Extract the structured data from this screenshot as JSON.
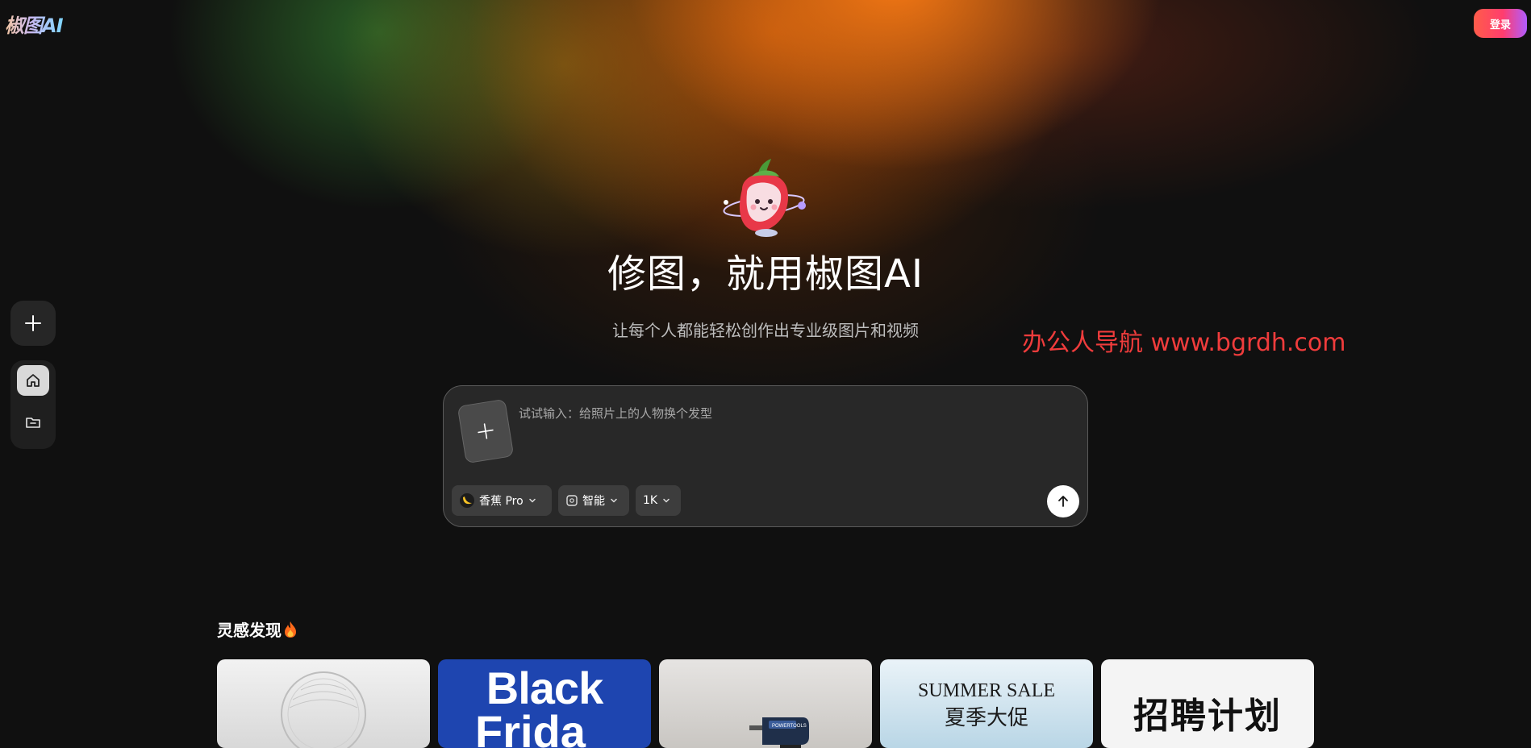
{
  "app": {
    "logo_text": "椒图AI",
    "login_label": "登录"
  },
  "sidebar": {
    "new_label": "",
    "items": [
      {
        "icon": "home-icon",
        "active": true
      },
      {
        "icon": "folder-icon",
        "active": false
      }
    ]
  },
  "hero": {
    "title": "修图，就用椒图AI",
    "subtitle": "让每个人都能轻松创作出专业级图片和视频"
  },
  "watermark": {
    "text": "办公人导航  www.bgrdh.com"
  },
  "composer": {
    "placeholder": "试试输入：给照片上的人物换个发型",
    "value": "",
    "model_label": "香蕉 Pro",
    "mode_label": "智能",
    "resolution_label": "1K"
  },
  "inspiration": {
    "title": "灵感发现",
    "cards": [
      {
        "kind": "fan",
        "text": ""
      },
      {
        "kind": "black-friday",
        "text_line1": "Black",
        "text_line2": "Frida"
      },
      {
        "kind": "drill",
        "text": "POWERTOOLS"
      },
      {
        "kind": "summer-sale",
        "text_en": "SUMMER SALE",
        "text_cn": "夏季大促"
      },
      {
        "kind": "recruit",
        "text": "招聘计划"
      }
    ]
  },
  "colors": {
    "background": "#101010",
    "accent_gradient_start": "#ff5c4a",
    "accent_gradient_end": "#b05cff",
    "watermark": "#f03c3c"
  }
}
